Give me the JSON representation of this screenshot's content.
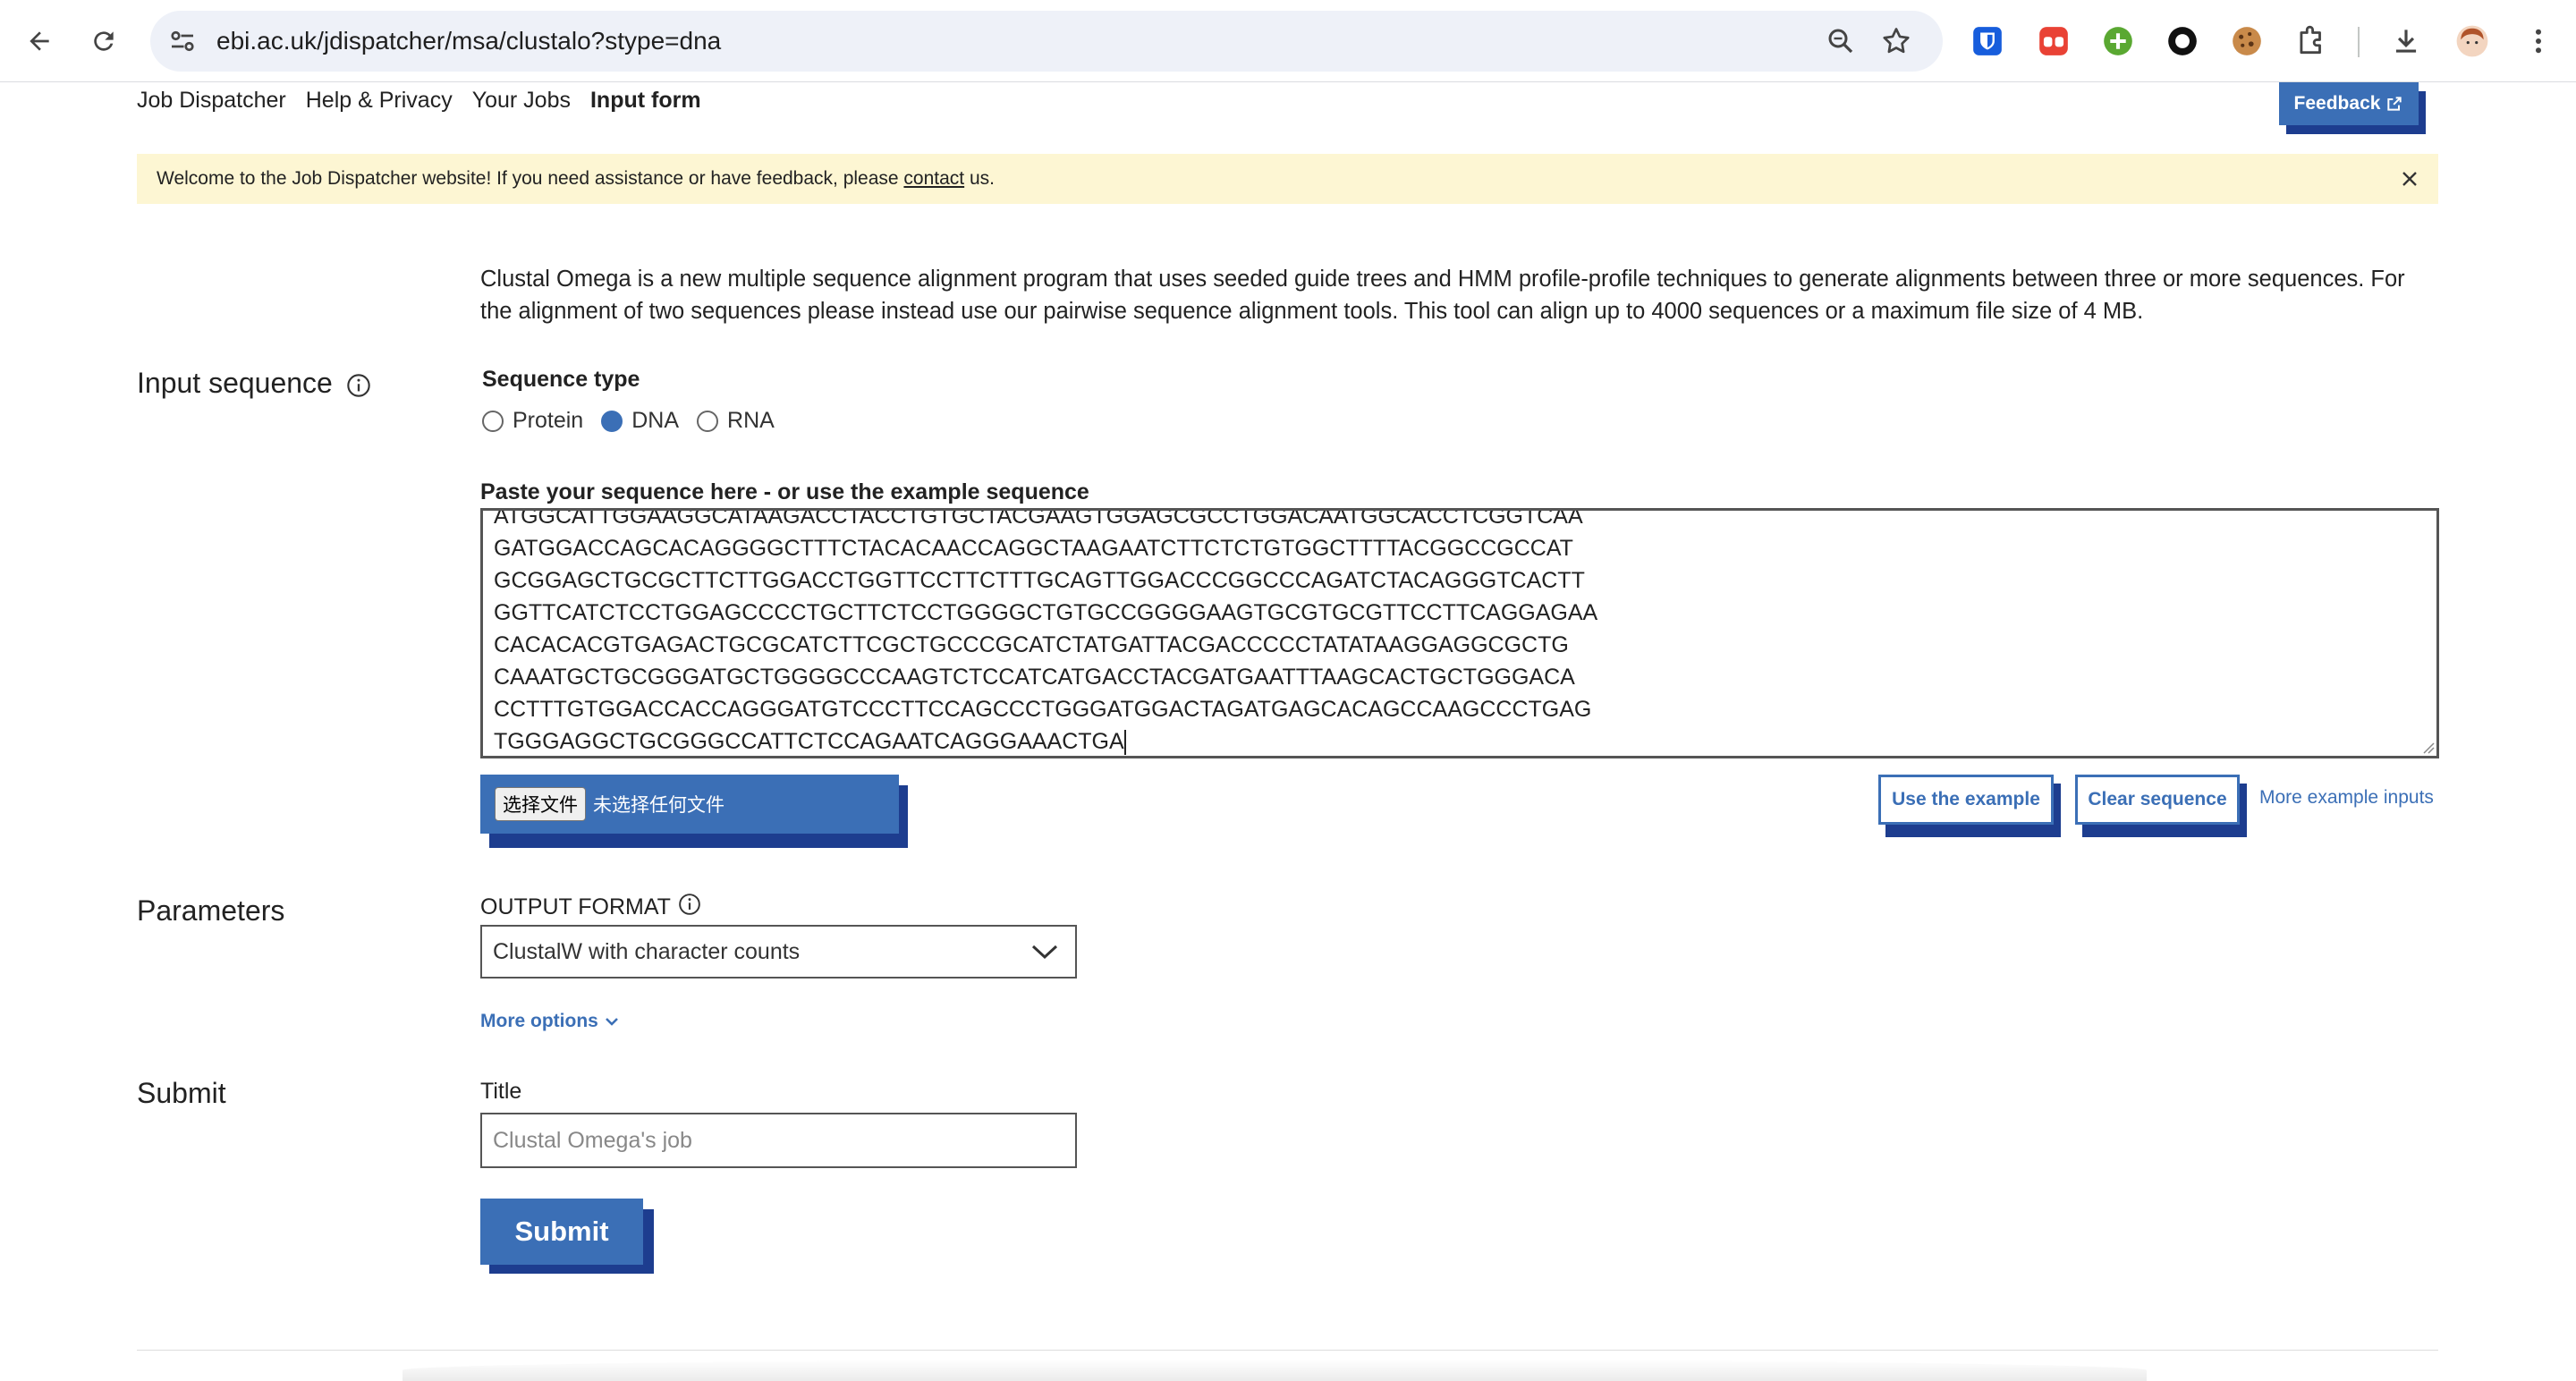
{
  "browser": {
    "url": "ebi.ac.uk/jdispatcher/msa/clustalo?stype=dna"
  },
  "topnav": {
    "items": [
      "Job Dispatcher",
      "Help & Privacy",
      "Your Jobs",
      "Input form"
    ],
    "active": "Input form",
    "feedback_label": "Feedback"
  },
  "banner": {
    "text_before": "Welcome to the Job Dispatcher website! If you need assistance or have feedback, please ",
    "link": "contact",
    "text_after": " us."
  },
  "intro": {
    "line1": "Clustal Omega is a new multiple sequence alignment program that uses seeded guide trees and HMM profile-profile techniques to generate alignments between three or more sequences. For",
    "line2": "the alignment of two sequences please instead use our pairwise sequence alignment tools. This tool can align up to 4000 sequences or a maximum file size of 4 MB."
  },
  "input_sequence": {
    "heading": "Input sequence",
    "sequence_type_label": "Sequence type",
    "options": [
      "Protein",
      "DNA",
      "RNA"
    ],
    "selected": "DNA",
    "paste_label": "Paste your sequence here - or use the example sequence",
    "lines": [
      "ATGGCATTGGAAGGCATAAGACCTACCTGTGCTACGAAGTGGAGCGCCTGGACAATGGCACCTCGGTCAA",
      "GATGGACCAGCACAGGGGCTTTCTACACAACCAGGCTAAGAATCTTCTCTGTGGCTTTTACGGCCGCCAT",
      "GCGGAGCTGCGCTTCTTGGACCTGGTTCCTTCTTTGCAGTTGGACCCGGCCCAGATCTACAGGGTCACTT",
      "GGTTCATCTCCTGGAGCCCCTGCTTCTCCTGGGGCTGTGCCGGGGAAGTGCGTGCGTTCCTTCAGGAGAA",
      "CACACACGTGAGACTGCGCATCTTCGCTGCCCGCATCTATGATTACGACCCCCTATATAAGGAGGCGCTG",
      "CAAATGCTGCGGGATGCTGGGGCCCAAGTCTCCATCATGACCTACGATGAATTTAAGCACTGCTGGGACA",
      "CCTTTGTGGACCACCAGGGATGTCCCTTCCAGCCCTGGGATGGACTAGATGAGCACAGCCAAGCCCTGAG",
      "TGGGAGGCTGCGGGCCATTCTCCAGAATCAGGGAAACTGA"
    ],
    "file_choose_label": "选择文件",
    "file_none_label": "未选择任何文件",
    "use_example_label": "Use the example",
    "clear_label": "Clear sequence",
    "more_examples_label": "More example inputs"
  },
  "parameters": {
    "heading": "Parameters",
    "output_format_label": "OUTPUT FORMAT",
    "output_format_value": "ClustalW with character counts",
    "more_options_label": "More options"
  },
  "submit": {
    "heading": "Submit",
    "title_label": "Title",
    "title_placeholder": "Clustal Omega's job",
    "button_label": "Submit"
  },
  "colors": {
    "accent": "#3b6fb6",
    "accent_shadow": "#1d3d8f",
    "banner_bg": "#fdf6d3"
  }
}
